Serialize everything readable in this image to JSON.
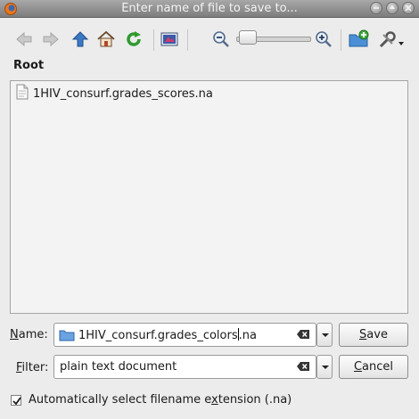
{
  "window": {
    "title": "Enter name of file to save to..."
  },
  "toolbar": {
    "icons": [
      "back-arrow-icon",
      "forward-arrow-icon",
      "up-arrow-icon",
      "home-icon",
      "reload-icon",
      "image-preview-icon",
      "zoom-out-icon",
      "zoom-slider",
      "zoom-in-icon",
      "new-folder-icon",
      "tools-icon"
    ],
    "zoom_level_fraction": 0.05
  },
  "location": {
    "label": "Root"
  },
  "files": [
    {
      "name": "1HIV_consurf.grades_scores.na"
    }
  ],
  "name_field": {
    "label_prefix": "N",
    "label_rest": "ame:",
    "value_before_cursor": "1HIV_consurf.grades_colors",
    "value_after_cursor": ".na"
  },
  "filter_field": {
    "label_prefix": "F",
    "label_rest": "ilter:",
    "value": "plain text document"
  },
  "buttons": {
    "save_prefix": "S",
    "save_rest": "ave",
    "cancel_prefix": "C",
    "cancel_rest": "ancel"
  },
  "auto_extension": {
    "checked": true,
    "label_before": "Automatically select filename e",
    "label_underlined": "x",
    "label_after": "tension (.na)"
  },
  "colors": {
    "accent_blue": "#3b78c4",
    "reload_green": "#2e9a2e"
  }
}
